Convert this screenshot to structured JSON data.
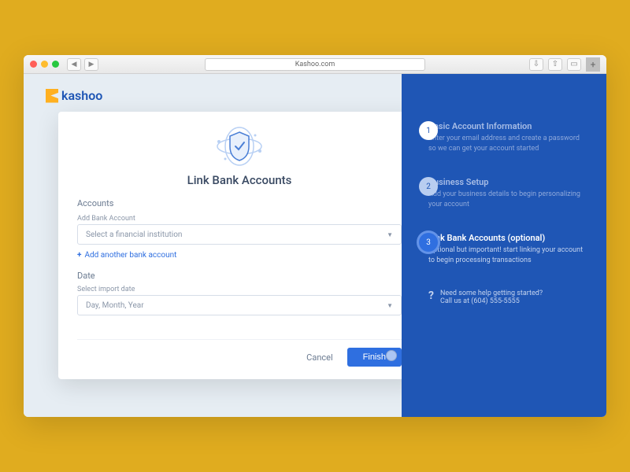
{
  "browser": {
    "url": "Kashoo.com"
  },
  "logo": {
    "text": "kashoo"
  },
  "modal": {
    "title": "Link Bank Accounts",
    "accounts": {
      "section_label": "Accounts",
      "field_label": "Add Bank Account",
      "placeholder": "Select a financial institution",
      "add_another": "Add another bank account"
    },
    "date": {
      "section_label": "Date",
      "field_label": "Select import date",
      "placeholder": "Day, Month, Year"
    },
    "footer": {
      "cancel": "Cancel",
      "finish": "Finish"
    }
  },
  "steps": [
    {
      "num": "1",
      "title": "Basic Account Information",
      "desc": "Enter your email address and create a password so we can get your account started",
      "state": "done"
    },
    {
      "num": "2",
      "title": "Business Setup",
      "desc": "Add your business details to begin personalizing your account",
      "state": "muted"
    },
    {
      "num": "3",
      "title": "Link Bank Accounts (optional)",
      "desc": "Optional but important! start linking your account to begin processing transactions",
      "state": "active"
    }
  ],
  "help": {
    "line1": "Need some help getting started?",
    "line2": "Call us at (604) 555-5555"
  }
}
